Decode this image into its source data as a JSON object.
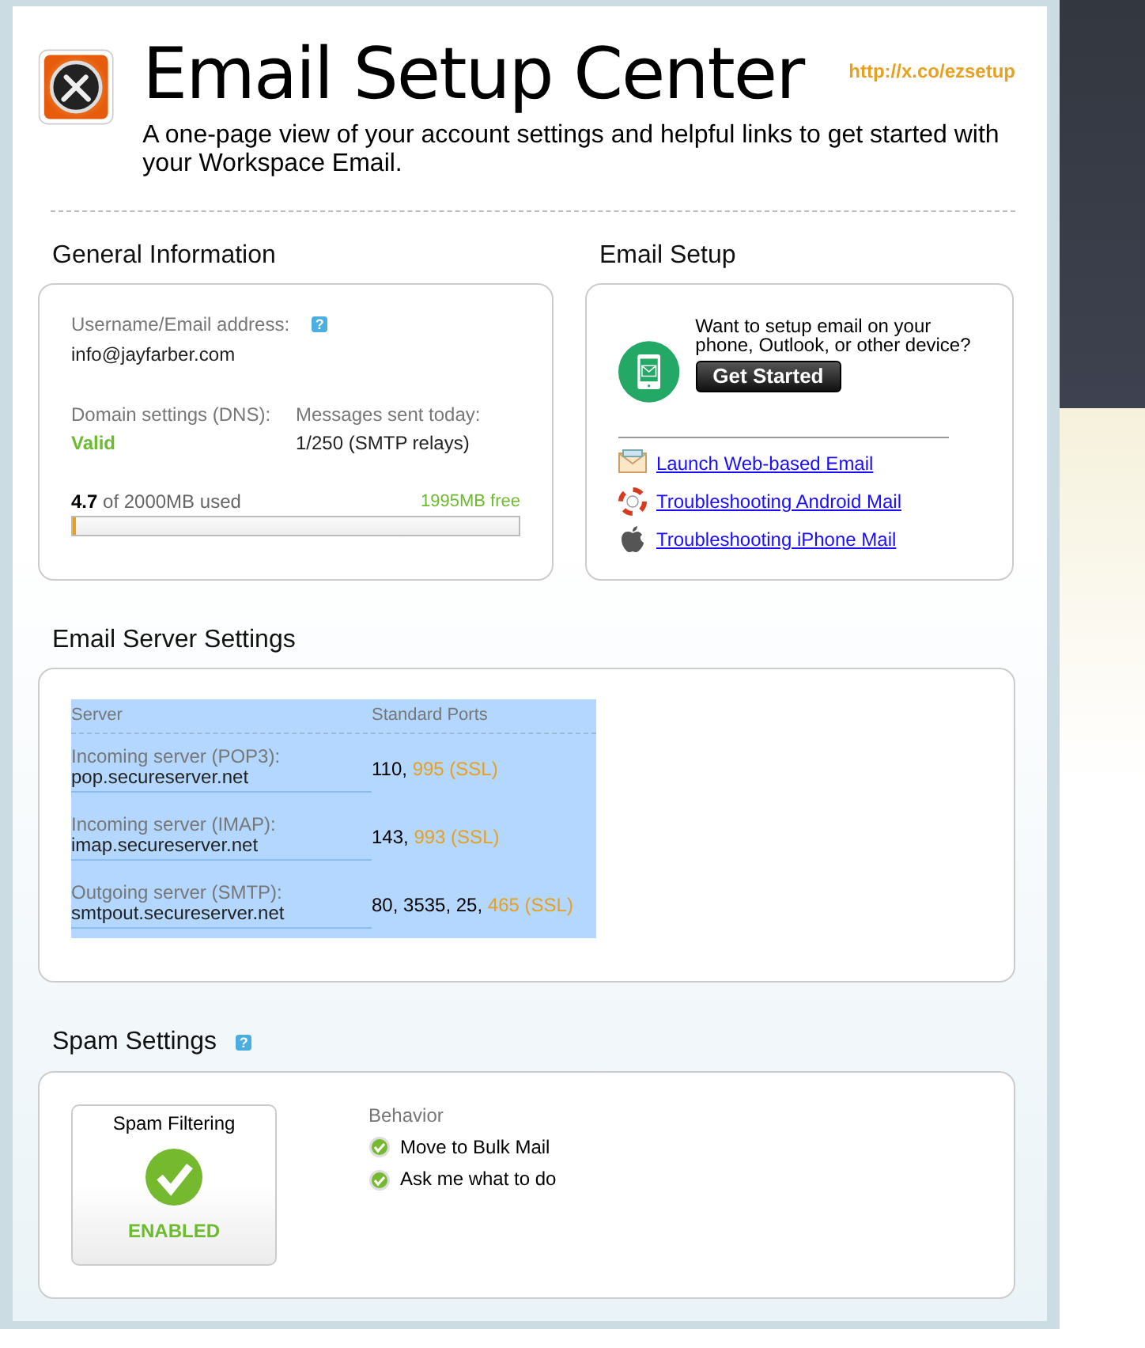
{
  "header": {
    "title": "Email Setup Center",
    "subtitle": "A one-page view of your account settings and helpful links to get started with your Workspace Email.",
    "link": "http://x.co/ezsetup"
  },
  "general": {
    "heading": "General Information",
    "help_icon": "?",
    "username_label": "Username/Email address:",
    "username": "info@jayfarber.com",
    "dns_label": "Domain settings (DNS):",
    "dns_value": "Valid",
    "messages_label": "Messages sent today:",
    "messages_value": "1/250 (SMTP relays)",
    "storage": {
      "used": "4.7",
      "used_rest": "of 2000MB used",
      "free": "1995MB free",
      "level": 0.0024
    }
  },
  "email_setup": {
    "heading": "Email Setup",
    "prompt": "Want to setup email on your phone, Outlook, or other device?",
    "button": "Get Started",
    "links": [
      {
        "kind": "envelope",
        "label": "Launch Web-based Email"
      },
      {
        "kind": "lifebuoy",
        "label": "Troubleshooting Android Mail"
      },
      {
        "kind": "apple",
        "label": "Troubleshooting iPhone Mail"
      }
    ]
  },
  "server_settings": {
    "heading": "Email Server Settings",
    "selected": true,
    "columns": [
      "Server",
      "Standard Ports"
    ],
    "rows": [
      {
        "label": "Incoming server (POP3):",
        "host": "pop.secureserver.net",
        "ports": "110, ",
        "ssl": "995 (SSL)"
      },
      {
        "label": "Incoming server (IMAP):",
        "host": "imap.secureserver.net",
        "ports": "143, ",
        "ssl": "993 (SSL)"
      },
      {
        "label": "Outgoing server (SMTP):",
        "host": "smtpout.secureserver.net",
        "ports": "80, 3535, 25, ",
        "ssl": "465 (SSL)"
      }
    ]
  },
  "spam": {
    "heading": "Spam Settings",
    "help_icon": "?",
    "filter_label": "Spam Filtering",
    "enabled": true,
    "status": "ENABLED",
    "behavior_label": "Behavior",
    "options": [
      {
        "label": "Move to Bulk Mail",
        "checked": true
      },
      {
        "label": "Ask me what to do",
        "checked": true
      }
    ]
  }
}
